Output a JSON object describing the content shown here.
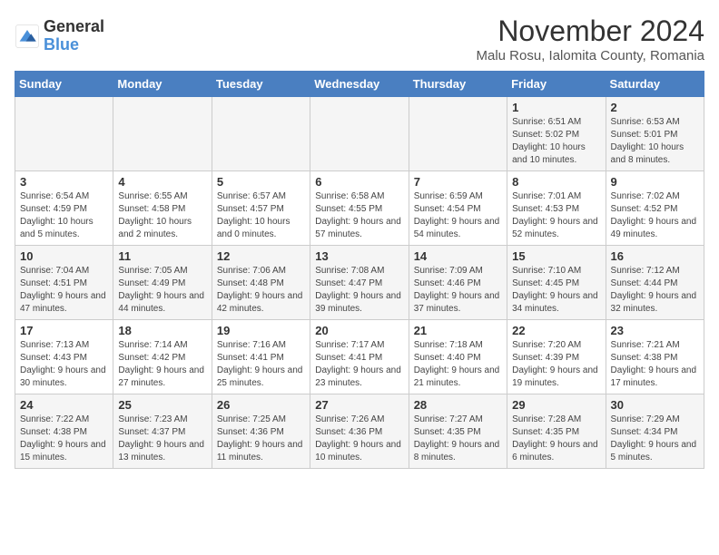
{
  "logo": {
    "general": "General",
    "blue": "Blue"
  },
  "title": {
    "month_year": "November 2024",
    "location": "Malu Rosu, Ialomita County, Romania"
  },
  "days_of_week": [
    "Sunday",
    "Monday",
    "Tuesday",
    "Wednesday",
    "Thursday",
    "Friday",
    "Saturday"
  ],
  "weeks": [
    [
      {
        "day": "",
        "info": ""
      },
      {
        "day": "",
        "info": ""
      },
      {
        "day": "",
        "info": ""
      },
      {
        "day": "",
        "info": ""
      },
      {
        "day": "",
        "info": ""
      },
      {
        "day": "1",
        "info": "Sunrise: 6:51 AM\nSunset: 5:02 PM\nDaylight: 10 hours and 10 minutes."
      },
      {
        "day": "2",
        "info": "Sunrise: 6:53 AM\nSunset: 5:01 PM\nDaylight: 10 hours and 8 minutes."
      }
    ],
    [
      {
        "day": "3",
        "info": "Sunrise: 6:54 AM\nSunset: 4:59 PM\nDaylight: 10 hours and 5 minutes."
      },
      {
        "day": "4",
        "info": "Sunrise: 6:55 AM\nSunset: 4:58 PM\nDaylight: 10 hours and 2 minutes."
      },
      {
        "day": "5",
        "info": "Sunrise: 6:57 AM\nSunset: 4:57 PM\nDaylight: 10 hours and 0 minutes."
      },
      {
        "day": "6",
        "info": "Sunrise: 6:58 AM\nSunset: 4:55 PM\nDaylight: 9 hours and 57 minutes."
      },
      {
        "day": "7",
        "info": "Sunrise: 6:59 AM\nSunset: 4:54 PM\nDaylight: 9 hours and 54 minutes."
      },
      {
        "day": "8",
        "info": "Sunrise: 7:01 AM\nSunset: 4:53 PM\nDaylight: 9 hours and 52 minutes."
      },
      {
        "day": "9",
        "info": "Sunrise: 7:02 AM\nSunset: 4:52 PM\nDaylight: 9 hours and 49 minutes."
      }
    ],
    [
      {
        "day": "10",
        "info": "Sunrise: 7:04 AM\nSunset: 4:51 PM\nDaylight: 9 hours and 47 minutes."
      },
      {
        "day": "11",
        "info": "Sunrise: 7:05 AM\nSunset: 4:49 PM\nDaylight: 9 hours and 44 minutes."
      },
      {
        "day": "12",
        "info": "Sunrise: 7:06 AM\nSunset: 4:48 PM\nDaylight: 9 hours and 42 minutes."
      },
      {
        "day": "13",
        "info": "Sunrise: 7:08 AM\nSunset: 4:47 PM\nDaylight: 9 hours and 39 minutes."
      },
      {
        "day": "14",
        "info": "Sunrise: 7:09 AM\nSunset: 4:46 PM\nDaylight: 9 hours and 37 minutes."
      },
      {
        "day": "15",
        "info": "Sunrise: 7:10 AM\nSunset: 4:45 PM\nDaylight: 9 hours and 34 minutes."
      },
      {
        "day": "16",
        "info": "Sunrise: 7:12 AM\nSunset: 4:44 PM\nDaylight: 9 hours and 32 minutes."
      }
    ],
    [
      {
        "day": "17",
        "info": "Sunrise: 7:13 AM\nSunset: 4:43 PM\nDaylight: 9 hours and 30 minutes."
      },
      {
        "day": "18",
        "info": "Sunrise: 7:14 AM\nSunset: 4:42 PM\nDaylight: 9 hours and 27 minutes."
      },
      {
        "day": "19",
        "info": "Sunrise: 7:16 AM\nSunset: 4:41 PM\nDaylight: 9 hours and 25 minutes."
      },
      {
        "day": "20",
        "info": "Sunrise: 7:17 AM\nSunset: 4:41 PM\nDaylight: 9 hours and 23 minutes."
      },
      {
        "day": "21",
        "info": "Sunrise: 7:18 AM\nSunset: 4:40 PM\nDaylight: 9 hours and 21 minutes."
      },
      {
        "day": "22",
        "info": "Sunrise: 7:20 AM\nSunset: 4:39 PM\nDaylight: 9 hours and 19 minutes."
      },
      {
        "day": "23",
        "info": "Sunrise: 7:21 AM\nSunset: 4:38 PM\nDaylight: 9 hours and 17 minutes."
      }
    ],
    [
      {
        "day": "24",
        "info": "Sunrise: 7:22 AM\nSunset: 4:38 PM\nDaylight: 9 hours and 15 minutes."
      },
      {
        "day": "25",
        "info": "Sunrise: 7:23 AM\nSunset: 4:37 PM\nDaylight: 9 hours and 13 minutes."
      },
      {
        "day": "26",
        "info": "Sunrise: 7:25 AM\nSunset: 4:36 PM\nDaylight: 9 hours and 11 minutes."
      },
      {
        "day": "27",
        "info": "Sunrise: 7:26 AM\nSunset: 4:36 PM\nDaylight: 9 hours and 10 minutes."
      },
      {
        "day": "28",
        "info": "Sunrise: 7:27 AM\nSunset: 4:35 PM\nDaylight: 9 hours and 8 minutes."
      },
      {
        "day": "29",
        "info": "Sunrise: 7:28 AM\nSunset: 4:35 PM\nDaylight: 9 hours and 6 minutes."
      },
      {
        "day": "30",
        "info": "Sunrise: 7:29 AM\nSunset: 4:34 PM\nDaylight: 9 hours and 5 minutes."
      }
    ]
  ]
}
